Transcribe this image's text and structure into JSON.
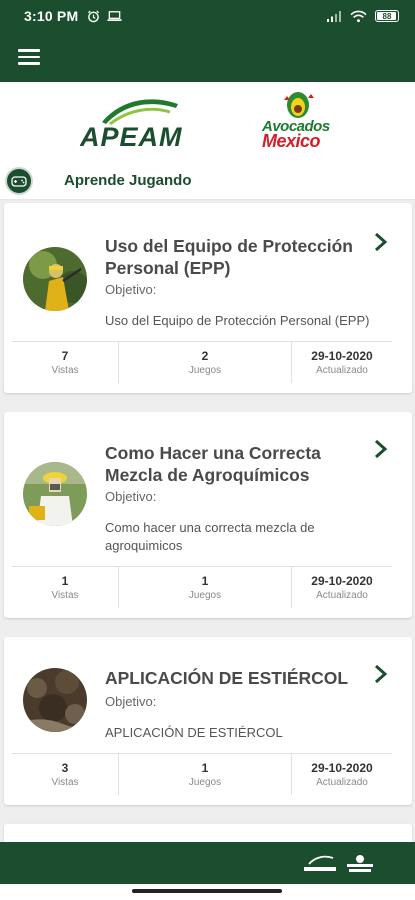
{
  "status_bar": {
    "time": "3:10 PM",
    "battery": "88",
    "left_icons": [
      "alarm-icon",
      "laptop-icon"
    ],
    "right_icons": [
      "signal-icon",
      "wifi-icon",
      "battery-icon"
    ]
  },
  "app_bar": {
    "menu_icon": "hamburger-menu-icon"
  },
  "header": {
    "logo_left": "APEAM",
    "logo_right_line1": "Avocados",
    "logo_right_line2": "Mexico"
  },
  "section": {
    "title": "Aprende Jugando",
    "icon": "game-controller-icon"
  },
  "cards": [
    {
      "title": "Uso del Equipo de Protección Personal (EPP)",
      "objective_label": "Objetivo:",
      "objective": "Uso del Equipo de Protección Personal (EPP)",
      "views_value": "7",
      "views_label": "Vistas",
      "games_value": "2",
      "games_label": "Juegos",
      "date_value": "29-10-2020",
      "date_label": "Actualizado"
    },
    {
      "title": "Como Hacer una Correcta Mezcla de Agroquímicos",
      "objective_label": "Objetivo:",
      "objective": "Como hacer una correcta mezcla de agroquimicos",
      "views_value": "1",
      "views_label": "Vistas",
      "games_value": "1",
      "games_label": "Juegos",
      "date_value": "29-10-2020",
      "date_label": "Actualizado"
    },
    {
      "title": "APLICACIÓN DE ESTIÉRCOL",
      "objective_label": "Objetivo:",
      "objective": "APLICACIÓN DE ESTIÉRCOL",
      "views_value": "3",
      "views_label": "Vistas",
      "games_value": "1",
      "games_label": "Juegos",
      "date_value": "29-10-2020",
      "date_label": "Actualizado"
    }
  ],
  "colors": {
    "primary": "#1b4d2f",
    "avocado_green": "#1f7a2e",
    "mexico_red": "#d3202a",
    "list_bg": "#eeeeee"
  }
}
